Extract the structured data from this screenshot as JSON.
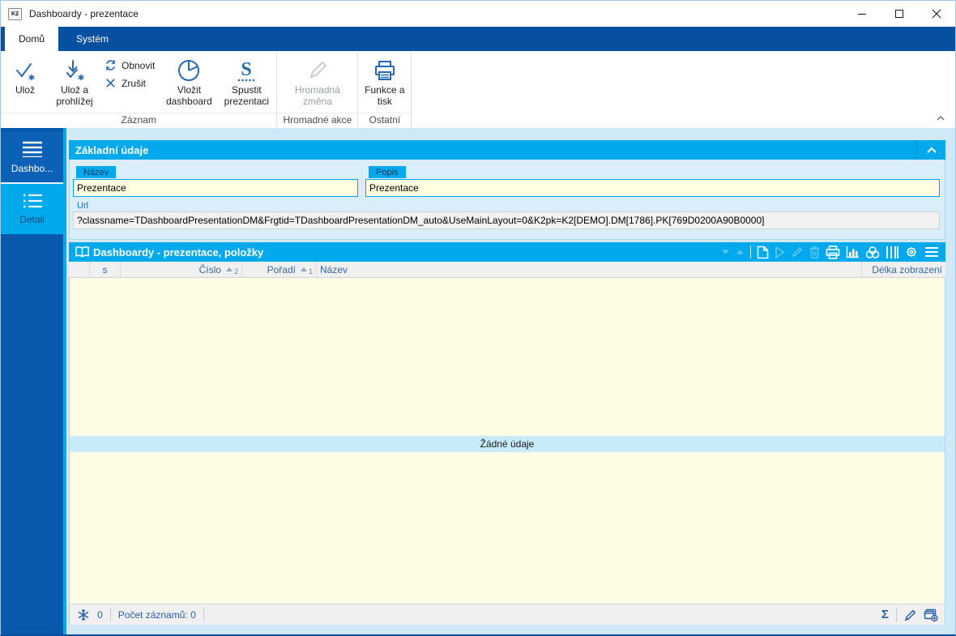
{
  "colors": {
    "accent_cyan": "#00a8ec",
    "tab_band_blue": "#07509f",
    "sidebar_blue": "#0859ae",
    "ribbon_icon_blue": "#2a68b0",
    "grid_body_yellow": "#fffce6",
    "empty_band_blue": "#c8ebfa",
    "field_yellow": "#fffee1"
  },
  "window": {
    "app_badge": "K2",
    "title": "Dashboardy - prezentace"
  },
  "tabs": [
    {
      "label": "Domů"
    },
    {
      "label": "Systém"
    }
  ],
  "ribbon": {
    "buttons": {
      "save": "Ulož",
      "save_and_view": "Ulož a prohlížej",
      "refresh": "Obnovit",
      "cancel": "Zrušit",
      "insert_dashboard": "Vložit dashboard",
      "run_presentation": "Spustit prezentaci",
      "bulk_change": "Hromadná změna",
      "functions_print": "Funkce a tisk"
    },
    "groups": {
      "record": "Záznam",
      "bulk": "Hromadné akce",
      "other": "Ostatní"
    }
  },
  "sidebar": {
    "items": [
      {
        "label": "Dashbo..."
      },
      {
        "label": "Detail"
      }
    ]
  },
  "basic_panel": {
    "title": "Základní údaje",
    "name_label": "Název",
    "name_value": "Prezentace",
    "desc_label": "Popis",
    "desc_value": "Prezentace",
    "url_label": "Url",
    "url_value": "?classname=TDashboardPresentationDM&Frgtid=TDashboardPresentationDM_auto&UseMainLayout=0&K2pk=K2[DEMO].DM[1786].PK[769D0200A90B0000]"
  },
  "grid_panel": {
    "title": "Dashboardy - prezentace, položky",
    "columns": [
      {
        "label": "s"
      },
      {
        "label": "Číslo",
        "sort_order": "2"
      },
      {
        "label": "Pořadí",
        "sort_order": "1"
      },
      {
        "label": "Název"
      },
      {
        "label": "Délka zobrazení"
      }
    ],
    "empty_message": "Žádné údaje",
    "status": {
      "locked_count": "0",
      "record_count": "Počet záznamů: 0",
      "sum_symbol": "Σ"
    }
  }
}
